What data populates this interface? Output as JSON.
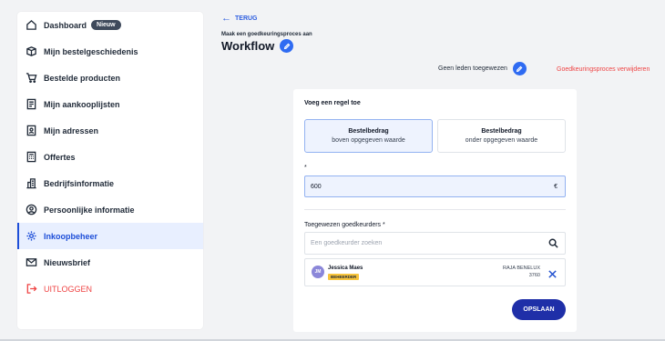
{
  "sidebar": {
    "items": [
      {
        "label": "Dashboard",
        "icon": "home-icon",
        "badge": "Nieuw"
      },
      {
        "label": "Mijn bestelgeschiedenis",
        "icon": "box-icon"
      },
      {
        "label": "Bestelde producten",
        "icon": "cart-icon"
      },
      {
        "label": "Mijn aankooplijsten",
        "icon": "list-icon"
      },
      {
        "label": "Mijn adressen",
        "icon": "address-card-icon"
      },
      {
        "label": "Offertes",
        "icon": "calculator-icon"
      },
      {
        "label": "Bedrijfsinformatie",
        "icon": "building-icon"
      },
      {
        "label": "Persoonlijke informatie",
        "icon": "user-circle-icon"
      },
      {
        "label": "Inkoopbeheer",
        "icon": "gear-icon",
        "active": true
      },
      {
        "label": "Nieuwsbrief",
        "icon": "mail-icon"
      },
      {
        "label": "UITLOGGEN",
        "icon": "logout-icon"
      }
    ]
  },
  "header": {
    "back_label": "TERUG",
    "subtitle": "Maak een goedkeuringsproces aan",
    "title": "Workflow",
    "members_text": "Geen leden toegewezen",
    "delete_label": "Goedkeuringsproces verwijderen"
  },
  "form": {
    "title": "Voeg een regel toe",
    "options": [
      {
        "line1": "Bestelbedrag",
        "line2": "boven opgegeven waarde",
        "selected": true
      },
      {
        "line1": "Bestelbedrag",
        "line2": "onder opgegeven waarde",
        "selected": false
      }
    ],
    "amount_label": "*",
    "amount_value": "600",
    "currency": "€",
    "approvers_label": "Toegewezen goedkeurders *",
    "search_placeholder": "Een goedkeurder zoeken",
    "approver": {
      "initials": "JM",
      "name": "Jessica Maes",
      "role": "BEHEERDER",
      "company": "RAJA BENELUX",
      "code": "3760"
    },
    "save_label": "OPSLAAN"
  },
  "colors": {
    "accent": "#2f6bf2",
    "primary_button": "#1f2fa8",
    "danger": "#ef4444",
    "role_badge": "#f7c43c"
  }
}
